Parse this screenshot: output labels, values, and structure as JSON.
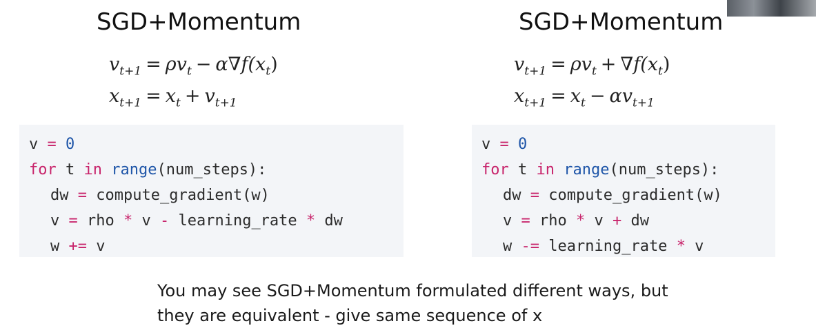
{
  "left": {
    "title": "SGD+Momentum",
    "eq1": {
      "lhs": "v",
      "lhs_sub": "t+1",
      "op": "=",
      "rhs": "ρv",
      "rhs_sub": "t",
      "op2": "−",
      "rhs2": "α∇f(x",
      "rhs2_sub": "t",
      "rhs2_end": ")"
    },
    "eq2": {
      "lhs": "x",
      "lhs_sub": "t+1",
      "op": "=",
      "rhs": "x",
      "rhs_sub": "t",
      "op2": "+",
      "rhs2": "v",
      "rhs2_sub": "t+1",
      "rhs2_end": ""
    },
    "code": [
      [
        {
          "t": "v ",
          "c": ""
        },
        {
          "t": "=",
          "c": "opc"
        },
        {
          "t": " ",
          "c": ""
        },
        {
          "t": "0",
          "c": "num"
        }
      ],
      [
        {
          "t": "for",
          "c": "kw"
        },
        {
          "t": " t ",
          "c": ""
        },
        {
          "t": "in",
          "c": "kw"
        },
        {
          "t": " ",
          "c": ""
        },
        {
          "t": "range",
          "c": "bi"
        },
        {
          "t": "(num_steps):",
          "c": ""
        }
      ],
      [
        {
          "t": "dw ",
          "c": ""
        },
        {
          "t": "=",
          "c": "opc"
        },
        {
          "t": " compute_gradient(w)",
          "c": ""
        }
      ],
      [
        {
          "t": "v ",
          "c": ""
        },
        {
          "t": "=",
          "c": "opc"
        },
        {
          "t": " rho ",
          "c": ""
        },
        {
          "t": "*",
          "c": "opc"
        },
        {
          "t": " v ",
          "c": ""
        },
        {
          "t": "-",
          "c": "opc"
        },
        {
          "t": " learning_rate ",
          "c": ""
        },
        {
          "t": "*",
          "c": "opc"
        },
        {
          "t": " dw",
          "c": ""
        }
      ],
      [
        {
          "t": "w ",
          "c": ""
        },
        {
          "t": "+=",
          "c": "opc"
        },
        {
          "t": " v",
          "c": ""
        }
      ]
    ]
  },
  "right": {
    "title": "SGD+Momentum",
    "eq1": {
      "lhs": "v",
      "lhs_sub": "t+1",
      "op": "=",
      "rhs": "ρv",
      "rhs_sub": "t",
      "op2": "+",
      "rhs2": "∇f(x",
      "rhs2_sub": "t",
      "rhs2_end": ")"
    },
    "eq2": {
      "lhs": "x",
      "lhs_sub": "t+1",
      "op": "=",
      "rhs": "x",
      "rhs_sub": "t",
      "op2": "−",
      "rhs2": "αv",
      "rhs2_sub": "t+1",
      "rhs2_end": ""
    },
    "code": [
      [
        {
          "t": "v ",
          "c": ""
        },
        {
          "t": "=",
          "c": "opc"
        },
        {
          "t": " ",
          "c": ""
        },
        {
          "t": "0",
          "c": "num"
        }
      ],
      [
        {
          "t": "for",
          "c": "kw"
        },
        {
          "t": " t ",
          "c": ""
        },
        {
          "t": "in",
          "c": "kw"
        },
        {
          "t": " ",
          "c": ""
        },
        {
          "t": "range",
          "c": "bi"
        },
        {
          "t": "(num_steps):",
          "c": ""
        }
      ],
      [
        {
          "t": "dw ",
          "c": ""
        },
        {
          "t": "=",
          "c": "opc"
        },
        {
          "t": " compute_gradient(w)",
          "c": ""
        }
      ],
      [
        {
          "t": "v ",
          "c": ""
        },
        {
          "t": "=",
          "c": "opc"
        },
        {
          "t": " rho ",
          "c": ""
        },
        {
          "t": "*",
          "c": "opc"
        },
        {
          "t": " v ",
          "c": ""
        },
        {
          "t": "+",
          "c": "opc"
        },
        {
          "t": " dw",
          "c": ""
        }
      ],
      [
        {
          "t": "w ",
          "c": ""
        },
        {
          "t": "-=",
          "c": "opc"
        },
        {
          "t": " learning_rate ",
          "c": ""
        },
        {
          "t": "*",
          "c": "opc"
        },
        {
          "t": " v",
          "c": ""
        }
      ]
    ]
  },
  "caption": {
    "line1": "You may see SGD+Momentum formulated different ways, but",
    "line2": "they are equivalent - give same sequence of x"
  }
}
